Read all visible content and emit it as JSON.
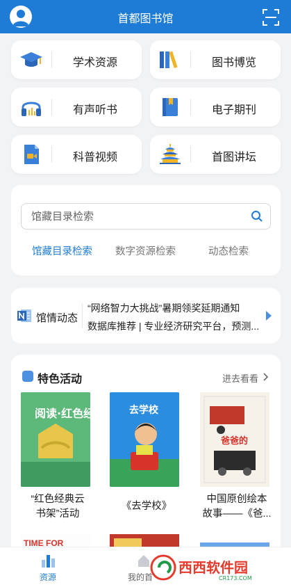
{
  "header": {
    "title": "首都图书馆",
    "avatar_icon": "user-avatar-icon",
    "scan_icon": "scan-icon"
  },
  "tiles": [
    {
      "label": "学术资源",
      "icon": "graduation-cap-icon"
    },
    {
      "label": "图书博览",
      "icon": "books-icon"
    },
    {
      "label": "有声听书",
      "icon": "headphones-icon"
    },
    {
      "label": "电子期刊",
      "icon": "journal-icon"
    },
    {
      "label": "科普视频",
      "icon": "video-file-icon"
    },
    {
      "label": "首图讲坛",
      "icon": "temple-icon"
    }
  ],
  "search": {
    "placeholder": "馆藏目录检索",
    "tabs": [
      "馆藏目录检索",
      "数字资源检索",
      "动态检索"
    ],
    "active_tab": 0
  },
  "news": {
    "label": "馆情动态",
    "lines": [
      "“网络智力大挑战”暑期领奖延期通知",
      "数据库推荐 | 专业经济研究平台，预测..."
    ]
  },
  "featured": {
    "title": "特色活动",
    "more": "进去看看",
    "items": [
      {
        "title_lines": [
          "“红色经典云",
          "书架”活动"
        ],
        "cover_text": "阅读·红色经典"
      },
      {
        "title_lines": [
          "《去学校》"
        ],
        "cover_text": "去学校"
      },
      {
        "title_lines": [
          "中国原创绘本",
          "故事——《爸..."
        ],
        "cover_text": "爸爸的火车是蓝色"
      }
    ]
  },
  "tabbar": {
    "items": [
      {
        "label": "资源",
        "active": true
      },
      {
        "label": "我的首"
      }
    ]
  },
  "watermark": {
    "text": "西西软件园",
    "sub": "CR173.COM"
  },
  "colors": {
    "primary": "#1f7cd6",
    "background": "#f2f3f5"
  }
}
